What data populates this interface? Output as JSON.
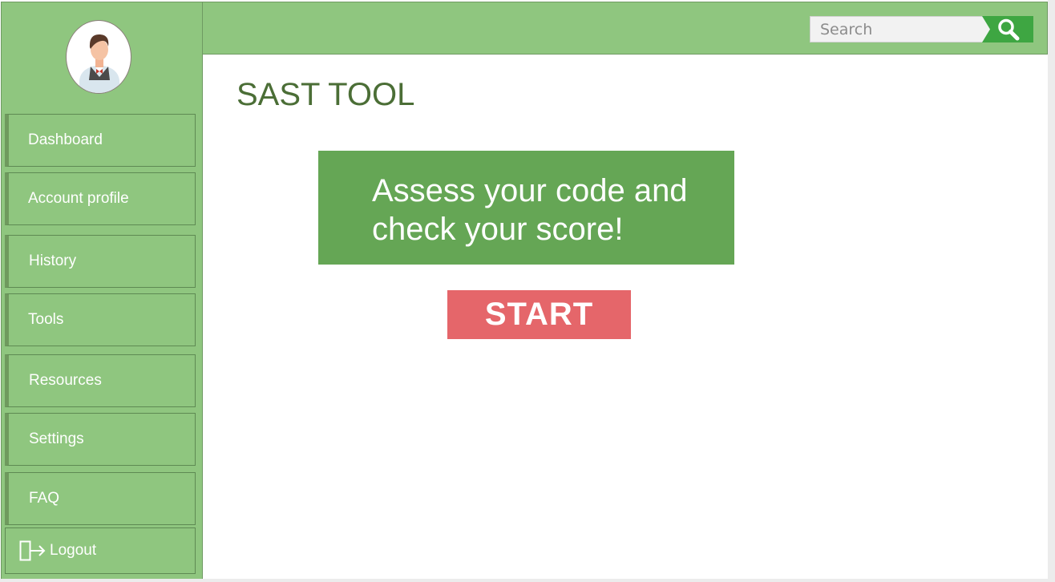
{
  "app": {
    "title": "SAST TOOL"
  },
  "sidebar": {
    "avatar_icon": "user-avatar-icon",
    "items": [
      {
        "label": "Dashboard"
      },
      {
        "label": "Account profile"
      },
      {
        "label": "History"
      },
      {
        "label": "Tools"
      },
      {
        "label": "Resources"
      },
      {
        "label": "Settings"
      },
      {
        "label": "FAQ"
      }
    ],
    "logout": {
      "label": "Logout",
      "icon": "logout-icon"
    }
  },
  "topbar": {
    "search": {
      "placeholder": "Search",
      "icon": "search-icon"
    }
  },
  "main": {
    "hero_line1": "Assess your code and",
    "hero_line2": "check your score!",
    "start_label": "START"
  },
  "colors": {
    "sidebar_bg": "#8fc67f",
    "hero_bg": "#65a655",
    "start_bg": "#e5666a",
    "title_text": "#4b6e36",
    "search_button": "#3ea642"
  }
}
